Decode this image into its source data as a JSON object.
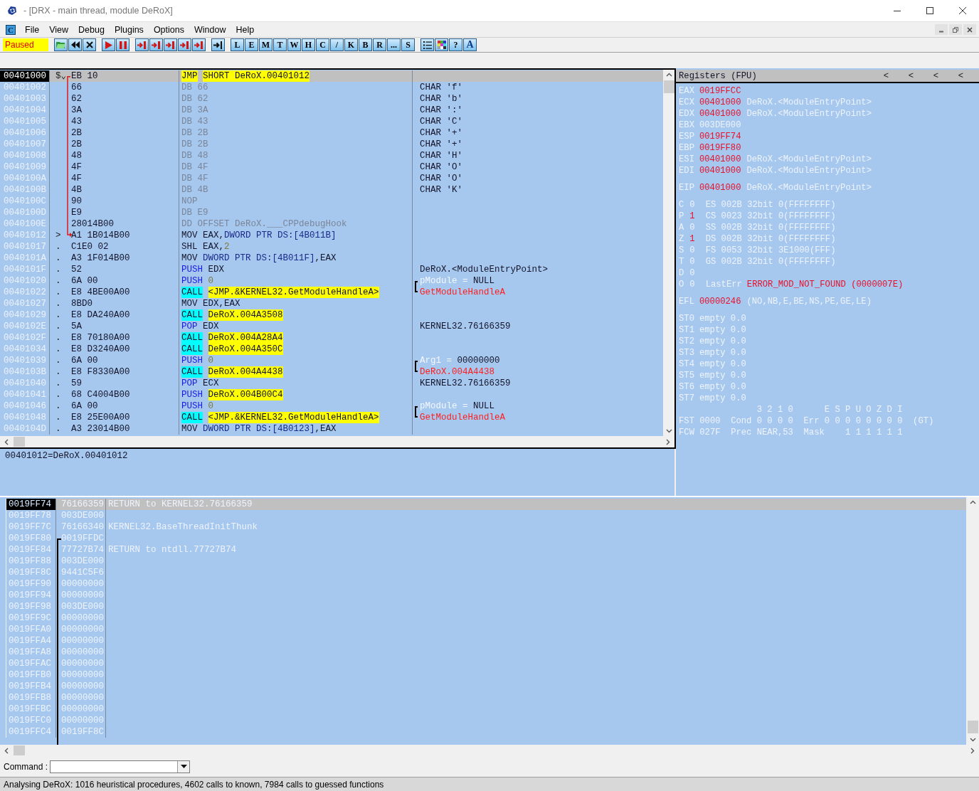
{
  "window": {
    "title": "- [DRX - main thread, module DeRoX]"
  },
  "menu": {
    "icon_label": "C",
    "items": [
      "File",
      "View",
      "Debug",
      "Plugins",
      "Options",
      "Window",
      "Help"
    ]
  },
  "toolbar": {
    "status": "Paused",
    "letters": [
      "L",
      "E",
      "M",
      "T",
      "W",
      "H",
      "C",
      "/",
      "K",
      "B",
      "R",
      "...",
      "S"
    ],
    "end_labels": [
      "?",
      "A"
    ]
  },
  "disassembly": {
    "rows": [
      {
        "address": "00401000",
        "mark": "$⌄",
        "hex": "EB 10",
        "mnemonic": "JMP",
        "kind": "jump",
        "ops": [
          {
            "text": "SHORT DeRoX.00401012",
            "kind": "target"
          }
        ],
        "selected": true
      },
      {
        "address": "00401002",
        "hex": "66",
        "mnemonic": "DB",
        "kind": "data",
        "ops": [
          {
            "text": "66",
            "kind": "data"
          }
        ],
        "comment": {
          "kind": "plain",
          "text": "CHAR 'f'"
        },
        "selected": false
      },
      {
        "address": "00401003",
        "hex": "62",
        "mnemonic": "DB",
        "kind": "data",
        "ops": [
          {
            "text": "62",
            "kind": "data"
          }
        ],
        "comment": {
          "kind": "plain",
          "text": "CHAR 'b'"
        },
        "selected": false
      },
      {
        "address": "00401004",
        "hex": "3A",
        "mnemonic": "DB",
        "kind": "data",
        "ops": [
          {
            "text": "3A",
            "kind": "data"
          }
        ],
        "comment": {
          "kind": "plain",
          "text": "CHAR ':'"
        },
        "selected": false
      },
      {
        "address": "00401005",
        "hex": "43",
        "mnemonic": "DB",
        "kind": "data",
        "ops": [
          {
            "text": "43",
            "kind": "data"
          }
        ],
        "comment": {
          "kind": "plain",
          "text": "CHAR 'C'"
        },
        "selected": false
      },
      {
        "address": "00401006",
        "hex": "2B",
        "mnemonic": "DB",
        "kind": "data",
        "ops": [
          {
            "text": "2B",
            "kind": "data"
          }
        ],
        "comment": {
          "kind": "plain",
          "text": "CHAR '+'"
        },
        "selected": false
      },
      {
        "address": "00401007",
        "hex": "2B",
        "mnemonic": "DB",
        "kind": "data",
        "ops": [
          {
            "text": "2B",
            "kind": "data"
          }
        ],
        "comment": {
          "kind": "plain",
          "text": "CHAR '+'"
        },
        "selected": false
      },
      {
        "address": "00401008",
        "hex": "48",
        "mnemonic": "DB",
        "kind": "data",
        "ops": [
          {
            "text": "48",
            "kind": "data"
          }
        ],
        "comment": {
          "kind": "plain",
          "text": "CHAR 'H'"
        },
        "selected": false
      },
      {
        "address": "00401009",
        "hex": "4F",
        "mnemonic": "DB",
        "kind": "data",
        "ops": [
          {
            "text": "4F",
            "kind": "data"
          }
        ],
        "comment": {
          "kind": "plain",
          "text": "CHAR 'O'"
        },
        "selected": false
      },
      {
        "address": "0040100A",
        "hex": "4F",
        "mnemonic": "DB",
        "kind": "data",
        "ops": [
          {
            "text": "4F",
            "kind": "data"
          }
        ],
        "comment": {
          "kind": "plain",
          "text": "CHAR 'O'"
        },
        "selected": false
      },
      {
        "address": "0040100B",
        "hex": "4B",
        "mnemonic": "DB",
        "kind": "data",
        "ops": [
          {
            "text": "4B",
            "kind": "data"
          }
        ],
        "comment": {
          "kind": "plain",
          "text": "CHAR 'K'"
        },
        "selected": false
      },
      {
        "address": "0040100C",
        "hex": "90",
        "mnemonic": "NOP",
        "kind": "data",
        "selected": false
      },
      {
        "address": "0040100D",
        "hex": "E9",
        "mnemonic": "DB",
        "kind": "data",
        "ops": [
          {
            "text": "E9",
            "kind": "data"
          }
        ],
        "selected": false
      },
      {
        "address": "0040100E",
        "hex": "28014B00",
        "mnemonic": "DD",
        "kind": "data",
        "ops": [
          {
            "text": "OFFSET DeRoX.___CPPdebugHook",
            "kind": "data"
          }
        ],
        "selected": false
      },
      {
        "address": "00401012",
        "mark": ">",
        "hex": "A1 1B014B00",
        "mnemonic": "MOV",
        "kind": "plain",
        "ops": [
          {
            "text": "EAX,",
            "kind": "plain"
          },
          {
            "text": "DWORD PTR DS:[4B011B]",
            "kind": "mem"
          }
        ],
        "selected": false
      },
      {
        "address": "00401017",
        "mark": ".",
        "hex": "C1E0 02",
        "mnemonic": "SHL",
        "kind": "plain",
        "ops": [
          {
            "text": "EAX,",
            "kind": "plain"
          },
          {
            "text": "2",
            "kind": "num"
          }
        ],
        "selected": false
      },
      {
        "address": "0040101A",
        "mark": ".",
        "hex": "A3 1F014B00",
        "mnemonic": "MOV",
        "kind": "plain",
        "ops": [
          {
            "text": "DWORD PTR DS:[4B011F]",
            "kind": "mem"
          },
          {
            "text": ",EAX",
            "kind": "plain"
          }
        ],
        "selected": false
      },
      {
        "address": "0040101F",
        "mark": ".",
        "hex": "52",
        "mnemonic": "PUSH",
        "kind": "stack",
        "ops": [
          {
            "text": "EDX",
            "kind": "plain"
          }
        ],
        "comment": {
          "kind": "plain",
          "text": "DeRoX.<ModuleEntryPoint>"
        },
        "selected": false
      },
      {
        "address": "00401020",
        "mark": ".",
        "hex": "6A 00",
        "mnemonic": "PUSH",
        "kind": "stack",
        "ops": [
          {
            "text": "0",
            "kind": "num"
          }
        ],
        "comment": {
          "kind": "arg",
          "name": "pModule =",
          "value": "NULL"
        },
        "selected": false
      },
      {
        "address": "00401022",
        "mark": ".",
        "hex": "E8 4BE00A00",
        "mnemonic": "CALL",
        "kind": "call",
        "ops": [
          {
            "text": "<JMP.&KERNEL32.GetModuleHandleA>",
            "kind": "target"
          }
        ],
        "comment": {
          "kind": "api",
          "text": "GetModuleHandleA"
        },
        "selected": false
      },
      {
        "address": "00401027",
        "mark": ".",
        "hex": "8BD0",
        "mnemonic": "MOV",
        "kind": "plain",
        "ops": [
          {
            "text": "EDX,EAX",
            "kind": "plain"
          }
        ],
        "selected": false
      },
      {
        "address": "00401029",
        "mark": ".",
        "hex": "E8 DA240A00",
        "mnemonic": "CALL",
        "kind": "call",
        "ops": [
          {
            "text": "DeRoX.004A3508",
            "kind": "target"
          }
        ],
        "selected": false
      },
      {
        "address": "0040102E",
        "mark": ".",
        "hex": "5A",
        "mnemonic": "POP",
        "kind": "stack",
        "ops": [
          {
            "text": "EDX",
            "kind": "plain"
          }
        ],
        "comment": {
          "kind": "plain",
          "text": "KERNEL32.76166359"
        },
        "selected": false
      },
      {
        "address": "0040102F",
        "mark": ".",
        "hex": "E8 70180A00",
        "mnemonic": "CALL",
        "kind": "call",
        "ops": [
          {
            "text": "DeRoX.004A28A4",
            "kind": "target"
          }
        ],
        "selected": false
      },
      {
        "address": "00401034",
        "mark": ".",
        "hex": "E8 D3240A00",
        "mnemonic": "CALL",
        "kind": "call",
        "ops": [
          {
            "text": "DeRoX.004A350C",
            "kind": "target"
          }
        ],
        "selected": false
      },
      {
        "address": "00401039",
        "mark": ".",
        "hex": "6A 00",
        "mnemonic": "PUSH",
        "kind": "stack",
        "ops": [
          {
            "text": "0",
            "kind": "num"
          }
        ],
        "comment": {
          "kind": "arg",
          "name": "Arg1 =",
          "value": "00000000"
        },
        "selected": false
      },
      {
        "address": "0040103B",
        "mark": ".",
        "hex": "E8 F8330A00",
        "mnemonic": "CALL",
        "kind": "call",
        "ops": [
          {
            "text": "DeRoX.004A4438",
            "kind": "target"
          }
        ],
        "comment": {
          "kind": "api",
          "text": "DeRoX.004A4438"
        },
        "selected": false
      },
      {
        "address": "00401040",
        "mark": ".",
        "hex": "59",
        "mnemonic": "POP",
        "kind": "stack",
        "ops": [
          {
            "text": "ECX",
            "kind": "plain"
          }
        ],
        "comment": {
          "kind": "plain",
          "text": "KERNEL32.76166359"
        },
        "selected": false
      },
      {
        "address": "00401041",
        "mark": ".",
        "hex": "68 C4004B00",
        "mnemonic": "PUSH",
        "kind": "stack",
        "ops": [
          {
            "text": "DeRoX.004B00C4",
            "kind": "target"
          }
        ],
        "selected": false
      },
      {
        "address": "00401046",
        "mark": ".",
        "hex": "6A 00",
        "mnemonic": "PUSH",
        "kind": "stack",
        "ops": [
          {
            "text": "0",
            "kind": "num"
          }
        ],
        "comment": {
          "kind": "arg",
          "name": "pModule =",
          "value": "NULL"
        },
        "selected": false
      },
      {
        "address": "00401048",
        "mark": ".",
        "hex": "E8 25E00A00",
        "mnemonic": "CALL",
        "kind": "call",
        "ops": [
          {
            "text": "<JMP.&KERNEL32.GetModuleHandleA>",
            "kind": "target"
          }
        ],
        "comment": {
          "kind": "api",
          "text": "GetModuleHandleA"
        },
        "selected": false
      },
      {
        "address": "0040104D",
        "mark": ".",
        "hex": "A3 23014B00",
        "mnemonic": "MOV",
        "kind": "plain",
        "ops": [
          {
            "text": "DWORD PTR DS:[4B0123]",
            "kind": "mem"
          },
          {
            "text": ",EAX",
            "kind": "plain"
          }
        ],
        "selected": false
      }
    ]
  },
  "registers": {
    "title": "Registers (FPU)",
    "header_buttons": [
      "<",
      "<",
      "<",
      "<"
    ],
    "general": [
      {
        "name": "EAX",
        "value": "0019FFCC",
        "changed": true
      },
      {
        "name": "ECX",
        "value": "00401000",
        "changed": true,
        "comment": "DeRoX.<ModuleEntryPoint>"
      },
      {
        "name": "EDX",
        "value": "00401000",
        "changed": true,
        "comment": "DeRoX.<ModuleEntryPoint>"
      },
      {
        "name": "EBX",
        "value": "003DE000",
        "changed": false
      },
      {
        "name": "ESP",
        "value": "0019FF74",
        "changed": true
      },
      {
        "name": "EBP",
        "value": "0019FF80",
        "changed": true
      },
      {
        "name": "ESI",
        "value": "00401000",
        "changed": true,
        "comment": "DeRoX.<ModuleEntryPoint>"
      },
      {
        "name": "EDI",
        "value": "00401000",
        "changed": true,
        "comment": "DeRoX.<ModuleEntryPoint>"
      }
    ],
    "eip": {
      "name": "EIP",
      "value": "00401000",
      "changed": true,
      "comment": "DeRoX.<ModuleEntryPoint>"
    },
    "flags": [
      {
        "name": "C",
        "value": "0",
        "changed": false,
        "segment": "ES 002B 32bit 0(FFFFFFFF)"
      },
      {
        "name": "P",
        "value": "1",
        "changed": true,
        "segment": "CS 0023 32bit 0(FFFFFFFF)"
      },
      {
        "name": "A",
        "value": "0",
        "changed": false,
        "segment": "SS 002B 32bit 0(FFFFFFFF)"
      },
      {
        "name": "Z",
        "value": "1",
        "changed": true,
        "segment": "DS 002B 32bit 0(FFFFFFFF)"
      },
      {
        "name": "S",
        "value": "0",
        "changed": false,
        "segment": "FS 0053 32bit 3E1000(FFF)"
      },
      {
        "name": "T",
        "value": "0",
        "changed": false,
        "segment": "GS 002B 32bit 0(FFFFFFFF)"
      },
      {
        "name": "D",
        "value": "0",
        "changed": false
      },
      {
        "name": "O",
        "value": "0",
        "changed": false
      }
    ],
    "last_error": {
      "label": "LastErr",
      "value": "ERROR_MOD_NOT_FOUND (0000007E)"
    },
    "efl": {
      "name": "EFL",
      "value": "00000246",
      "changed": true,
      "comment": "(NO,NB,E,BE,NS,PE,GE,LE)"
    },
    "fpu": [
      {
        "name": "ST0",
        "value": "empty 0.0"
      },
      {
        "name": "ST1",
        "value": "empty 0.0"
      },
      {
        "name": "ST2",
        "value": "empty 0.0"
      },
      {
        "name": "ST3",
        "value": "empty 0.0"
      },
      {
        "name": "ST4",
        "value": "empty 0.0"
      },
      {
        "name": "ST5",
        "value": "empty 0.0"
      },
      {
        "name": "ST6",
        "value": "empty 0.0"
      },
      {
        "name": "ST7",
        "value": "empty 0.0"
      }
    ],
    "fpu_status": [
      "               3 2 1 0      E S P U O Z D I",
      "FST 0000  Cond 0 0 0 0  Err 0 0 0 0 0 0 0 0  (GT)",
      "FCW 027F  Prec NEAR,53  Mask    1 1 1 1 1 1"
    ]
  },
  "info": "00401012=DeRoX.00401012",
  "stack": {
    "rows": [
      {
        "address": "0019FF74",
        "value": "76166359",
        "comment": "RETURN to KERNEL32.76166359",
        "selected": true
      },
      {
        "address": "0019FF78",
        "value": "003DE000",
        "selected": false
      },
      {
        "address": "0019FF7C",
        "value": "76166340",
        "comment": "KERNEL32.BaseThreadInitThunk",
        "selected": false
      },
      {
        "address": "0019FF80",
        "value": "0019FFDC",
        "selected": false
      },
      {
        "address": "0019FF84",
        "value": "77727B74",
        "comment": "RETURN to ntdll.77727B74",
        "selected": false
      },
      {
        "address": "0019FF88",
        "value": "003DE000",
        "selected": false
      },
      {
        "address": "0019FF8C",
        "value": "9441C5F6",
        "selected": false
      },
      {
        "address": "0019FF90",
        "value": "00000000",
        "selected": false
      },
      {
        "address": "0019FF94",
        "value": "00000000",
        "selected": false
      },
      {
        "address": "0019FF98",
        "value": "003DE000",
        "selected": false
      },
      {
        "address": "0019FF9C",
        "value": "00000000",
        "selected": false
      },
      {
        "address": "0019FFA0",
        "value": "00000000",
        "selected": false
      },
      {
        "address": "0019FFA4",
        "value": "00000000",
        "selected": false
      },
      {
        "address": "0019FFA8",
        "value": "00000000",
        "selected": false
      },
      {
        "address": "0019FFAC",
        "value": "00000000",
        "selected": false
      },
      {
        "address": "0019FFB0",
        "value": "00000000",
        "selected": false
      },
      {
        "address": "0019FFB4",
        "value": "00000000",
        "selected": false
      },
      {
        "address": "0019FFB8",
        "value": "00000000",
        "selected": false
      },
      {
        "address": "0019FFBC",
        "value": "00000000",
        "selected": false
      },
      {
        "address": "0019FFC0",
        "value": "00000000",
        "selected": false
      },
      {
        "address": "0019FFC4",
        "value": "0019FF8C",
        "selected": false
      }
    ]
  },
  "command": {
    "label": "Command :"
  },
  "status_bar": "Analysing DeRoX: 1016 heuristical procedures, 4602 calls to known, 7984 calls to guessed functions"
}
